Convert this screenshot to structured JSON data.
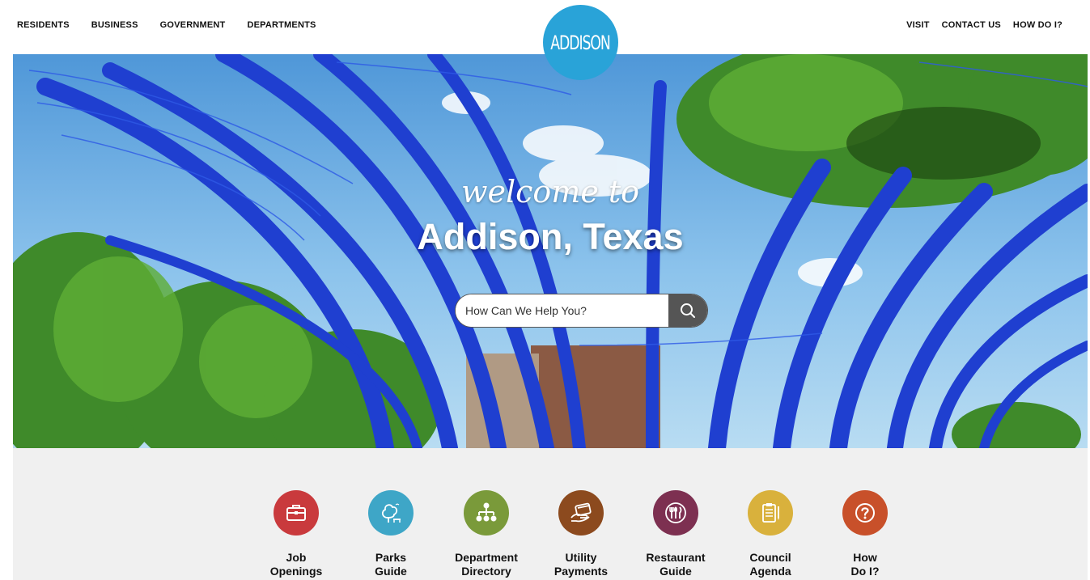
{
  "header": {
    "left_nav": [
      "RESIDENTS",
      "BUSINESS",
      "GOVERNMENT",
      "DEPARTMENTS"
    ],
    "right_nav": [
      "VISIT",
      "CONTACT US",
      "HOW DO I?"
    ],
    "logo_text": "ADDISON",
    "logo_color": "#29a3d8"
  },
  "hero": {
    "welcome": "welcome to",
    "title": "Addison, Texas",
    "search_placeholder": "How Can We Help You?",
    "search_icon": "search-icon"
  },
  "quick_links": [
    {
      "line1": "Job",
      "line2": "Openings",
      "color": "#c93a3d",
      "icon": "briefcase-icon"
    },
    {
      "line1": "Parks",
      "line2": "Guide",
      "color": "#3ea6c7",
      "icon": "park-bench-tree-icon"
    },
    {
      "line1": "Department",
      "line2": "Directory",
      "color": "#7a9a3a",
      "icon": "org-chart-icon"
    },
    {
      "line1": "Utility",
      "line2": "Payments",
      "color": "#8c4a1e",
      "icon": "payment-card-icon"
    },
    {
      "line1": "Restaurant",
      "line2": "Guide",
      "color": "#7d3051",
      "icon": "utensils-icon"
    },
    {
      "line1": "Council",
      "line2": "Agenda",
      "color": "#d9b13c",
      "icon": "clipboard-icon"
    },
    {
      "line1": "How",
      "line2": "Do I?",
      "color": "#c8502a",
      "icon": "question-icon"
    }
  ]
}
